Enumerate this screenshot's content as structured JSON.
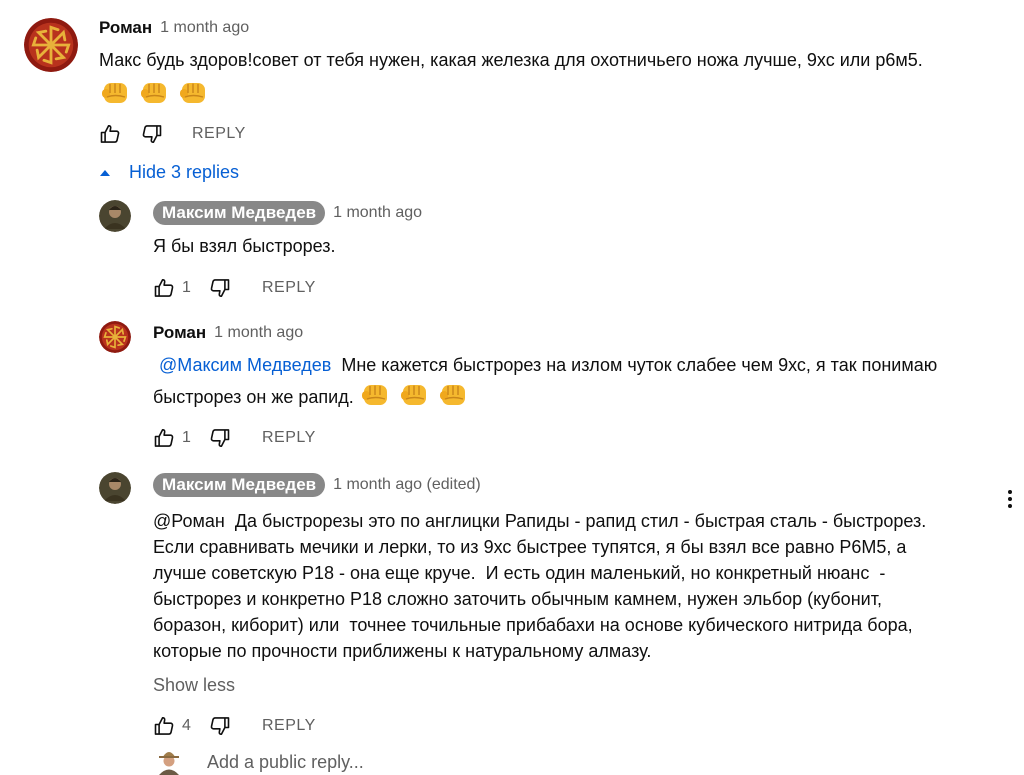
{
  "comment": {
    "author": "Роман",
    "time": "1 month ago",
    "text": "Макс будь здоров!совет от тебя нужен, какая железка для охотничьего ножа лучше, 9хс или р6м5.",
    "reply_label": "REPLY"
  },
  "replies_toggle": {
    "label": "Hide 3 replies"
  },
  "replies": [
    {
      "author": "Максим Медведев",
      "time": "1 month ago",
      "text": "Я бы взял быстрорез.",
      "likes": "1",
      "reply_label": "REPLY"
    },
    {
      "author": "Роман",
      "time": "1 month ago",
      "mention": "@Максим Медведев",
      "text_line1": "  Мне кажется быстрорез на излом чуток слабее чем 9хс, я так понимаю",
      "text_line2": "быстрорез он же рапид.",
      "likes": "1",
      "reply_label": "REPLY"
    },
    {
      "author": "Максим Медведев",
      "time": "1 month ago (edited)",
      "lines": [
        "@Роман  Да быстрорезы это по англицки Рапиды - рапид стил - быстрая сталь - быстрорез.",
        "Если сравнивать мечики и лерки, то из 9хс быстрее тупятся, я бы взял все равно Р6М5, а",
        "лучше советскую Р18 - она еще круче.  И есть один маленький, но конкретный нюанс  -",
        "быстрорез и конкретно Р18 сложно заточить обычным камнем, нужен эльбор (кубонит,",
        "боразон, киборит) или  точнее точильные прибабахи на основе кубического нитрида бора,",
        "которые по прочности приближены к натуральному алмазу."
      ],
      "show_less": "Show less",
      "likes": "4",
      "reply_label": "REPLY"
    }
  ],
  "reply_box": {
    "placeholder": "Add a public reply..."
  },
  "icons": [
    "like-icon",
    "dislike-icon",
    "caret-up-icon",
    "more-vert-icon",
    "fist-emoji"
  ],
  "colors": {
    "link": "#065fd4",
    "secondary": "#606060",
    "author_chip": "#888888",
    "emoji": "#f5b82e"
  }
}
